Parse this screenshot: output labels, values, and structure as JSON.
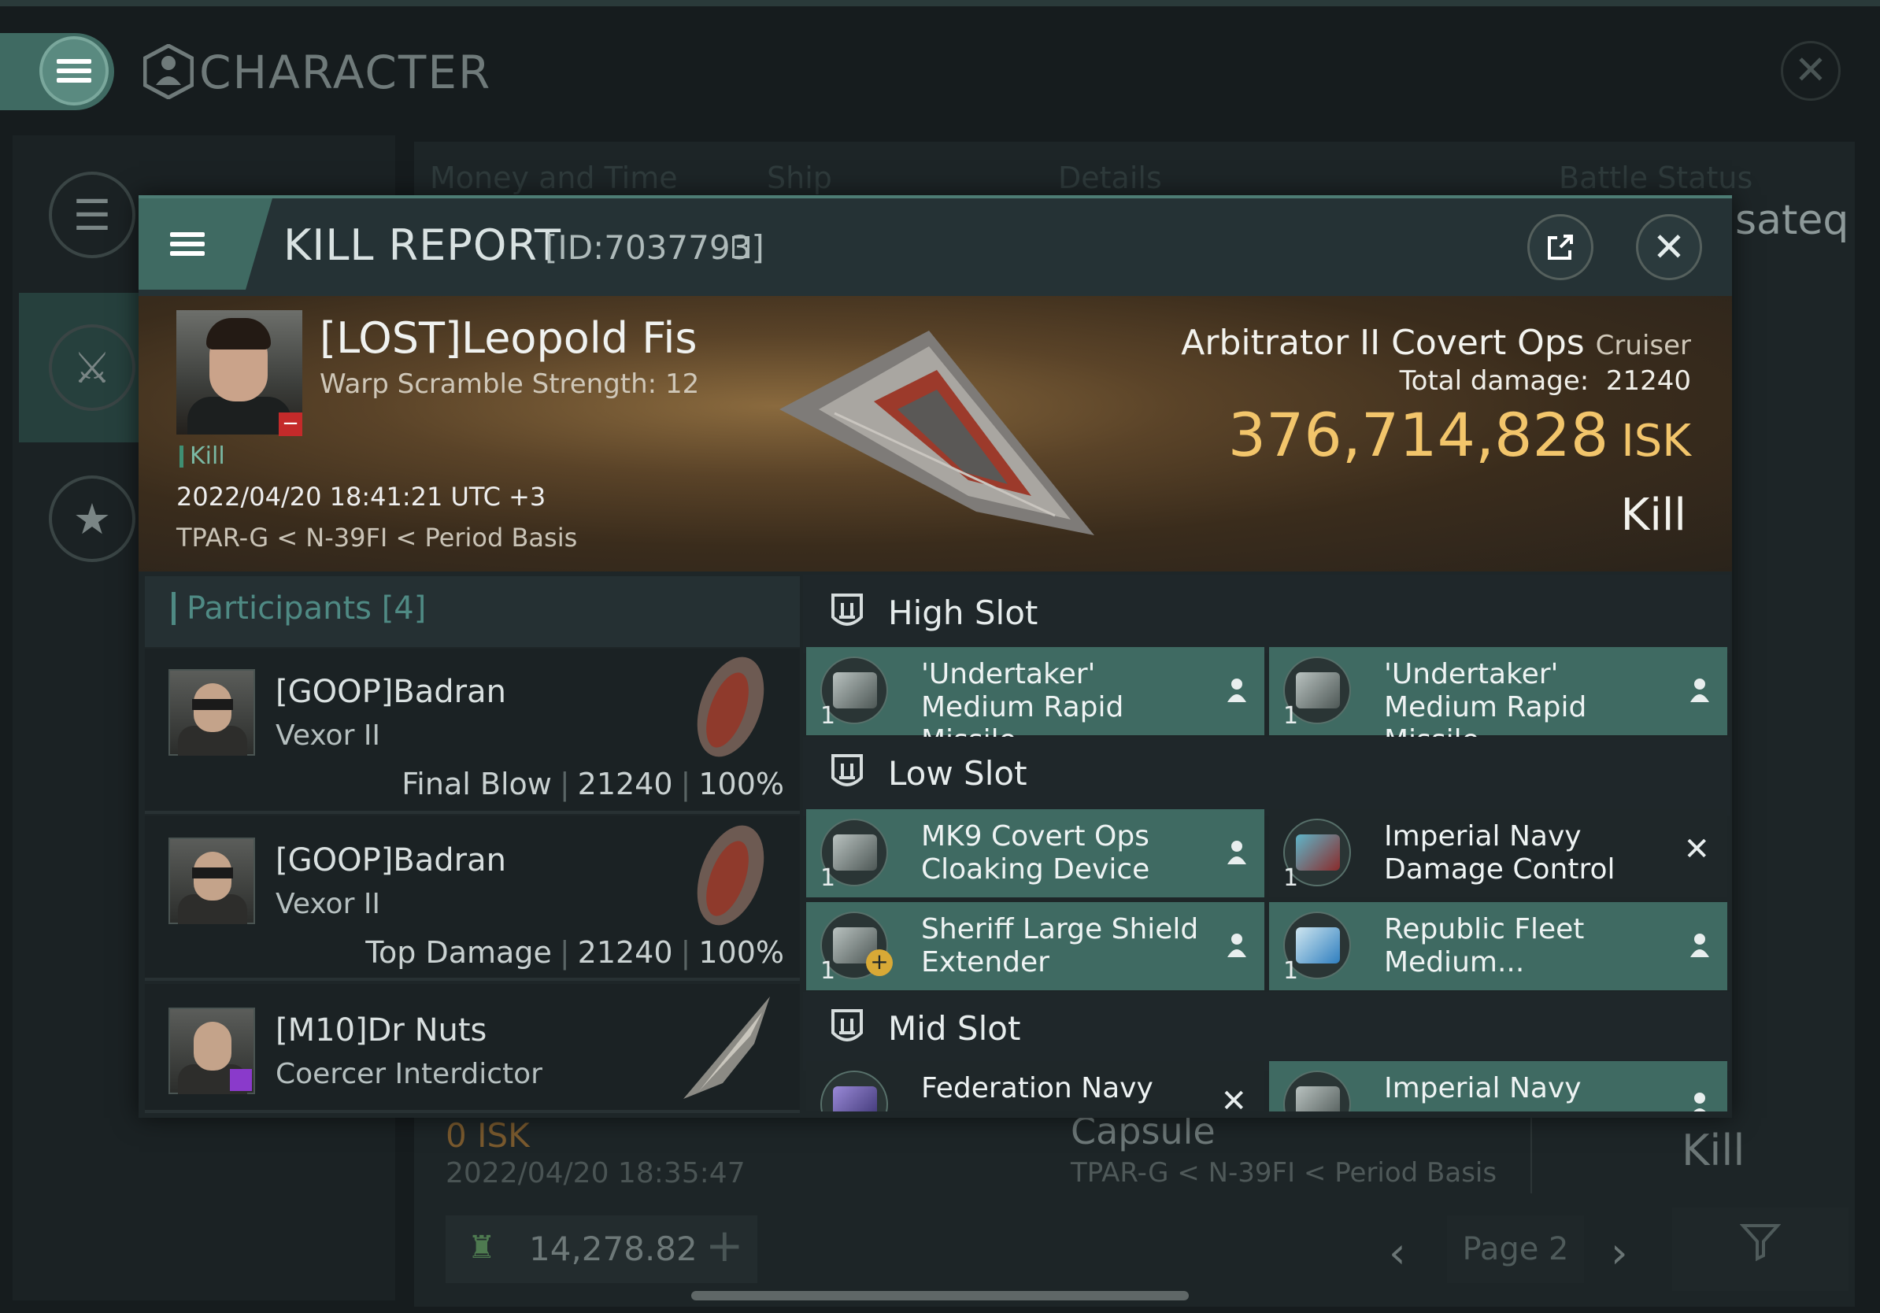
{
  "window": {
    "title": "CHARACTER",
    "close_glyph": "✕"
  },
  "background": {
    "headers": [
      "Money and Time",
      "Ship",
      "Details",
      "Battle Status"
    ],
    "right_partial_text": "sateq",
    "kill_label": "Kill",
    "row_isk": "0  ISK",
    "row_date": "2022/04/20  18:35:47",
    "row_ship": "Capsule",
    "row_location": "TPAR-G < N-39FI < Period Basis",
    "wallet_value": "14,278.82",
    "page_label": "Page 2"
  },
  "dialog": {
    "title": "KILL REPORT",
    "id_text": "[ID:7037793]",
    "victim": {
      "name": "[LOST]Leopold Fis",
      "warp_scramble": "Warp Scramble Strength: 12",
      "tag": "Kill",
      "datetime": "2022/04/20 18:41:21 UTC +3",
      "location": "TPAR-G < N-39FI < Period Basis"
    },
    "ship": {
      "name": "Arbitrator II Covert Ops",
      "class": "Cruiser",
      "total_damage_label": "Total damage:",
      "total_damage_value": "21240",
      "isk_value": "376,714,828",
      "isk_unit": "ISK",
      "result": "Kill"
    },
    "participants": {
      "title": "Participants",
      "count": "[4]",
      "rows": [
        {
          "name": "[GOOP]Badran",
          "ship": "Vexor II",
          "role": "Final Blow",
          "damage": "21240",
          "percent": "100%"
        },
        {
          "name": "[GOOP]Badran",
          "ship": "Vexor II",
          "role": "Top Damage",
          "damage": "21240",
          "percent": "100%"
        },
        {
          "name": "[M10]Dr Nuts",
          "ship": "Coercer Interdictor",
          "role": "",
          "damage": "",
          "percent": ""
        }
      ]
    },
    "slots": {
      "high": {
        "title": "High Slot",
        "modules": [
          {
            "name": "'Undertaker' Medium Rapid Missile...",
            "qty": "1",
            "status": "fitted"
          },
          {
            "name": "'Undertaker' Medium Rapid Missile...",
            "qty": "1",
            "status": "fitted"
          }
        ]
      },
      "low": {
        "title": "Low Slot",
        "modules": [
          {
            "name": "MK9 Covert Ops Cloaking Device",
            "qty": "1",
            "status": "fitted"
          },
          {
            "name": "Imperial Navy Damage Control",
            "qty": "1",
            "status": "destroyed"
          },
          {
            "name": "Sheriff Large Shield Extender",
            "qty": "1",
            "status": "fitted"
          },
          {
            "name": "Republic Fleet Medium...",
            "qty": "1",
            "status": "fitted"
          }
        ]
      },
      "mid": {
        "title": "Mid Slot",
        "modules": [
          {
            "name": "Federation Navy",
            "status": "destroyed"
          },
          {
            "name": "Imperial Navy",
            "status": "fitted"
          }
        ]
      }
    }
  }
}
